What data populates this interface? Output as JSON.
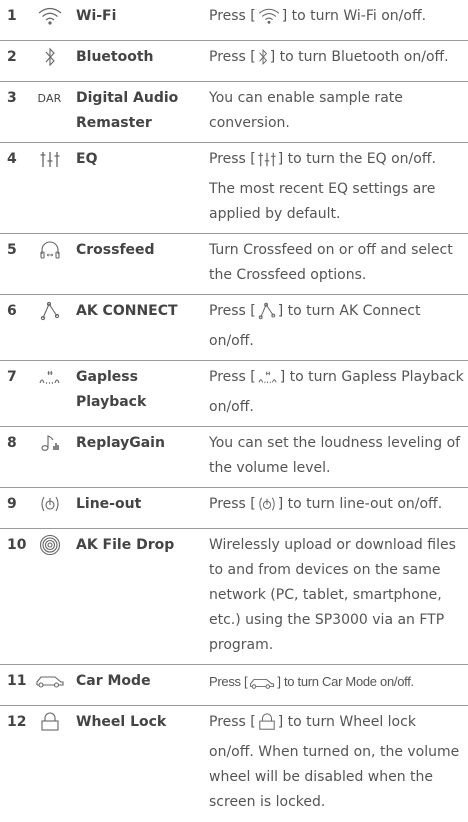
{
  "rows": [
    {
      "num": "1",
      "icon": "wifi-icon",
      "name": "Wi-Fi",
      "d1": "Press [",
      "d2": "] to turn Wi-Fi on/off."
    },
    {
      "num": "2",
      "icon": "bluetooth-icon",
      "name": "Bluetooth",
      "d1": "Press [",
      "d2": "] to turn Bluetooth on/off."
    },
    {
      "num": "3",
      "icon": "dar-icon",
      "icon_text": "DAR",
      "name": "Digital Audio Remaster",
      "desc": "You can enable sample rate conversion."
    },
    {
      "num": "4",
      "icon": "eq-icon",
      "name": "EQ",
      "d1": "Press [",
      "d2": "] to turn the EQ on/off. The most recent EQ settings are applied by default."
    },
    {
      "num": "5",
      "icon": "headphones-crossfeed-icon",
      "name": "Crossfeed",
      "desc": "Turn Crossfeed on or off and select the Crossfeed options."
    },
    {
      "num": "6",
      "icon": "ak-connect-icon",
      "name": "AK CONNECT",
      "d1": "Press [",
      "d2": "] to turn AK Connect on/off."
    },
    {
      "num": "7",
      "icon": "gapless-icon",
      "name": "Gapless Playback",
      "d1": "Press [",
      "d2": "] to turn Gapless Playback on/off."
    },
    {
      "num": "8",
      "icon": "replaygain-icon",
      "name": "ReplayGain",
      "desc": "You can set the loudness leveling of the volume level."
    },
    {
      "num": "9",
      "icon": "line-out-icon",
      "name": "Line-out",
      "d1": "Press [",
      "d2": "] to turn line-out on/off."
    },
    {
      "num": "10",
      "icon": "ak-file-drop-icon",
      "name": "AK File Drop",
      "desc": "Wirelessly upload or download files to and from devices on the same network (PC, tablet, smartphone, etc.) using the SP3000 via an FTP program."
    },
    {
      "num": "11",
      "icon": "car-mode-icon",
      "name": "Car Mode",
      "d1": "Press [",
      "d2": "] to turn Car Mode on/off."
    },
    {
      "num": "12",
      "icon": "wheel-lock-icon",
      "name": "Wheel Lock",
      "d1": "Press [",
      "d2": "] to turn Wheel lock on/off. When turned on, the volume wheel will be disabled when the screen is locked."
    }
  ]
}
